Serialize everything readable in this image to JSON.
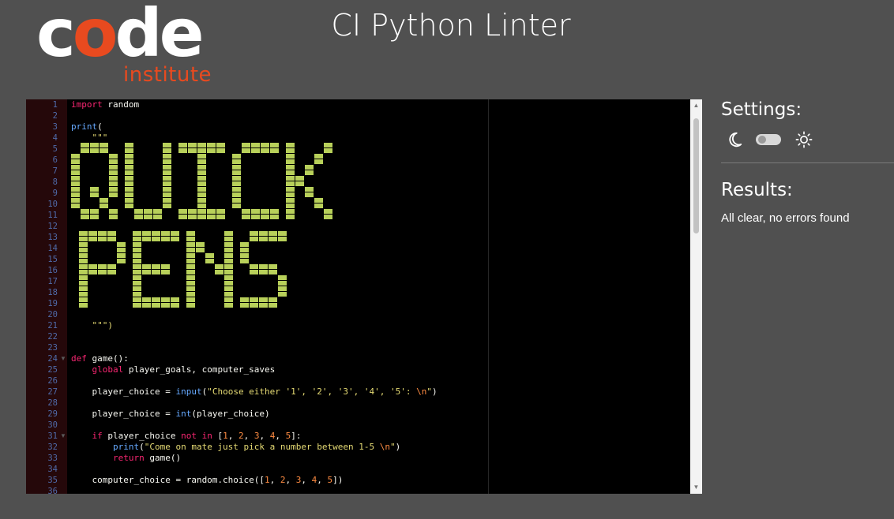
{
  "logo": {
    "word_c": "c",
    "word_o": "o",
    "word_rest": "de",
    "sub": "institute"
  },
  "page_title": "CI Python Linter",
  "editor": {
    "line_numbers": [
      "1",
      "2",
      "3",
      "4",
      "5",
      "6",
      "7",
      "8",
      "9",
      "10",
      "11",
      "12",
      "13",
      "14",
      "15",
      "16",
      "17",
      "18",
      "19",
      "20",
      "21",
      "22",
      "23",
      "24",
      "25",
      "26",
      "27",
      "28",
      "29",
      "30",
      "31",
      "32",
      "33",
      "34",
      "35",
      "36"
    ],
    "fold_markers": [
      "24",
      "31"
    ],
    "code": {
      "l1_kw": "import",
      "l1_rest": " random",
      "l3_bi": "print",
      "l3_rest": "(",
      "l4": "    \"\"\"",
      "l21": "    \"\"\")",
      "l24_kw": "def",
      "l24_rest": " game():",
      "l25_kw": "    global",
      "l25_rest": " player_goals, computer_saves",
      "l27_a": "    player_choice = ",
      "l27_bi": "input",
      "l27_b": "(",
      "l27_st": "\"Choose either '1', '2', '3', '4', '5': ",
      "l27_nu": "\\n",
      "l27_st2": "\"",
      "l27_c": ")",
      "l29_a": "    player_choice = ",
      "l29_bi": "int",
      "l29_b": "(player_choice)",
      "l31_kw": "    if",
      "l31_a": " player_choice ",
      "l31_kw2": "not in",
      "l31_b": " [",
      "l31_n1": "1",
      "l31_n2": "2",
      "l31_n3": "3",
      "l31_n4": "4",
      "l31_n5": "5",
      "l31_c": "]:",
      "l32_bi": "        print",
      "l32_a": "(",
      "l32_st": "\"Come on mate just pick a number between 1-5 ",
      "l32_nu": "\\n",
      "l32_st2": "\"",
      "l32_b": ")",
      "l33_kw": "        return",
      "l33_rest": " game()",
      "l35_a": "    computer_choice = random.choice([",
      "l35_n1": "1",
      "l35_n2": "2",
      "l35_n3": "3",
      "l35_n4": "4",
      "l35_n5": "5",
      "l35_b": "])"
    },
    "ascii_art_words": [
      "QUICK",
      "PENS"
    ],
    "ascii_art_color": "#b8d05a"
  },
  "settings": {
    "title": "Settings:",
    "theme_toggle_state": "off"
  },
  "results": {
    "title": "Results:",
    "message": "All clear, no errors found"
  },
  "colors": {
    "background": "#505050",
    "editor_bg": "#000000",
    "gutter_bg": "#25080a",
    "brand_orange": "#e84a1f"
  }
}
